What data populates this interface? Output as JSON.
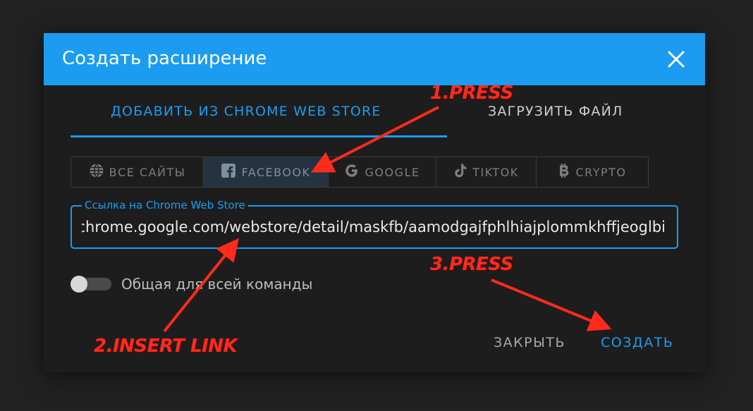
{
  "dialog": {
    "title": "Создать расширение",
    "header_color": "#1b9cf0"
  },
  "tabs": [
    {
      "label": "ДОБАВИТЬ ИЗ CHROME WEB STORE",
      "active": true
    },
    {
      "label": "ЗАГРУЗИТЬ ФАЙЛ",
      "active": false
    }
  ],
  "filters": [
    {
      "label": "ВСЕ САЙТЫ",
      "icon": "globe-icon",
      "active": false
    },
    {
      "label": "FACEBOOK",
      "icon": "facebook-icon",
      "active": true
    },
    {
      "label": "GOOGLE",
      "icon": "google-icon",
      "active": false
    },
    {
      "label": "TIKTOK",
      "icon": "tiktok-icon",
      "active": false
    },
    {
      "label": "CRYPTO",
      "icon": "bitcoin-icon",
      "active": false
    }
  ],
  "link_field": {
    "label": "Ссылка на Chrome Web Store",
    "value": "https://chrome.google.com/webstore/detail/maskfb/aamodgajfphlhiajplommkhffjeoglbi"
  },
  "team_toggle": {
    "label": "Общая для всей команды",
    "enabled": false
  },
  "actions": {
    "close_label": "ЗАКРЫТЬ",
    "create_label": "СОЗДАТЬ"
  },
  "annotations": {
    "step1": "1.PRESS",
    "step2": "2.INSERT LINK",
    "step3": "3.PRESS",
    "color": "#ff2b1c"
  }
}
